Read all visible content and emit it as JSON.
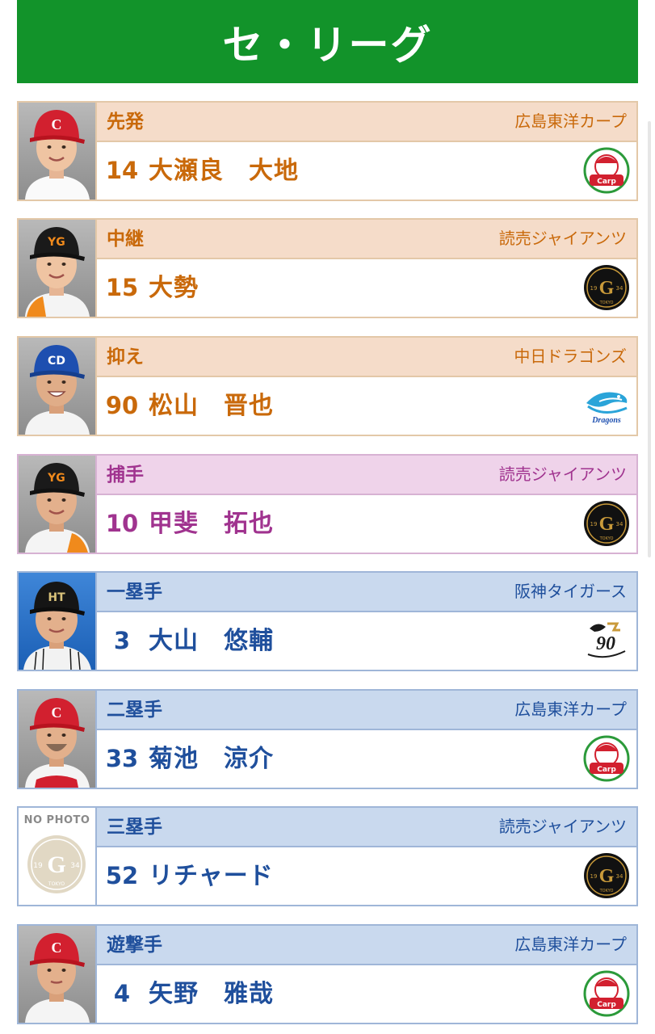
{
  "header": {
    "title": "セ・リーグ"
  },
  "cards": [
    {
      "position": "先発",
      "team": "広島東洋カープ",
      "number": "14",
      "player": "大瀬良　大地",
      "theme": "orange",
      "logo": "carp-logo-icon",
      "photo": "player-photo-red-cap"
    },
    {
      "position": "中継",
      "team": "読売ジャイアンツ",
      "number": "15",
      "player": "大勢",
      "theme": "orange",
      "logo": "giants-logo-icon",
      "photo": "player-photo-black-cap"
    },
    {
      "position": "抑え",
      "team": "中日ドラゴンズ",
      "number": "90",
      "player": "松山　晋也",
      "theme": "orange",
      "logo": "dragons-logo-icon",
      "photo": "player-photo-blue-cap"
    },
    {
      "position": "捕手",
      "team": "読売ジャイアンツ",
      "number": "10",
      "player": "甲斐　拓也",
      "theme": "purple",
      "logo": "giants-logo-icon",
      "photo": "player-photo-black-cap"
    },
    {
      "position": "一塁手",
      "team": "阪神タイガース",
      "number": "3",
      "player": "大山　悠輔",
      "theme": "blue",
      "logo": "tigers-logo-icon",
      "photo": "player-photo-black-cap"
    },
    {
      "position": "二塁手",
      "team": "広島東洋カープ",
      "number": "33",
      "player": "菊池　涼介",
      "theme": "blue",
      "logo": "carp-logo-icon",
      "photo": "player-photo-red-cap"
    },
    {
      "position": "三塁手",
      "team": "読売ジャイアンツ",
      "number": "52",
      "player": "リチャード",
      "theme": "blue",
      "logo": "giants-logo-icon",
      "photo": "no-photo"
    },
    {
      "position": "遊撃手",
      "team": "広島東洋カープ",
      "number": "4",
      "player": "矢野　雅哉",
      "theme": "blue",
      "logo": "carp-logo-icon",
      "photo": "player-photo-red-cap"
    }
  ],
  "no_photo_text": "NO PHOTO",
  "giants_logo_text": {
    "left": "19",
    "right": "34",
    "bottom": "TOKYO"
  },
  "dragons_logo_text": "Dragons",
  "colors": {
    "header_bg": "#12932a",
    "pitcher": "#c9690a",
    "catcher": "#a0338f",
    "infielder": "#1f4f9c"
  }
}
